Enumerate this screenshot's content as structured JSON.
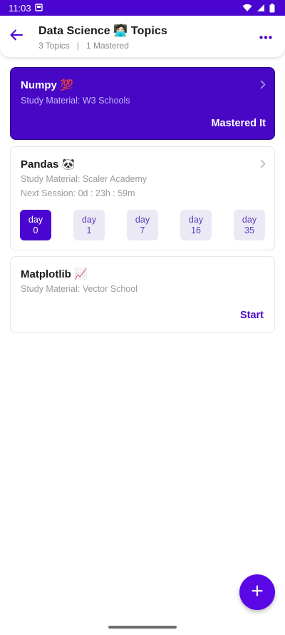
{
  "status_bar": {
    "time": "11:03",
    "icons": [
      "screenshot-icon",
      "wifi-icon",
      "signal-icon",
      "battery-icon"
    ]
  },
  "header": {
    "title": "Data Science 🧑🏻‍💻 Topics",
    "topics_count": "3 Topics",
    "separator": "|",
    "mastered_count": "1 Mastered",
    "back_icon": "arrow-left-icon",
    "more_icon": "more-horizontal-icon"
  },
  "topics": [
    {
      "title": "Numpy 💯",
      "material": "Study Material: W3 Schools",
      "status_label": "Mastered It"
    },
    {
      "title": "Pandas 🐼",
      "material": "Study Material: Scaler Academy",
      "next_session": "Next Session: 0d : 23h : 59m",
      "days": [
        {
          "label": "day",
          "number": "0"
        },
        {
          "label": "day",
          "number": "1"
        },
        {
          "label": "day",
          "number": "7"
        },
        {
          "label": "day",
          "number": "16"
        },
        {
          "label": "day",
          "number": "35"
        }
      ],
      "active_day": "0"
    },
    {
      "title": "Matplotlib 📈",
      "material": "Study Material: Vector School",
      "action_label": "Start"
    }
  ],
  "fab": {
    "icon": "plus-icon"
  },
  "colors": {
    "accent": "#4a06d0",
    "mastered_card": "#4707c4",
    "chip_bg": "#ece9f6",
    "fab": "#5a08e6"
  }
}
